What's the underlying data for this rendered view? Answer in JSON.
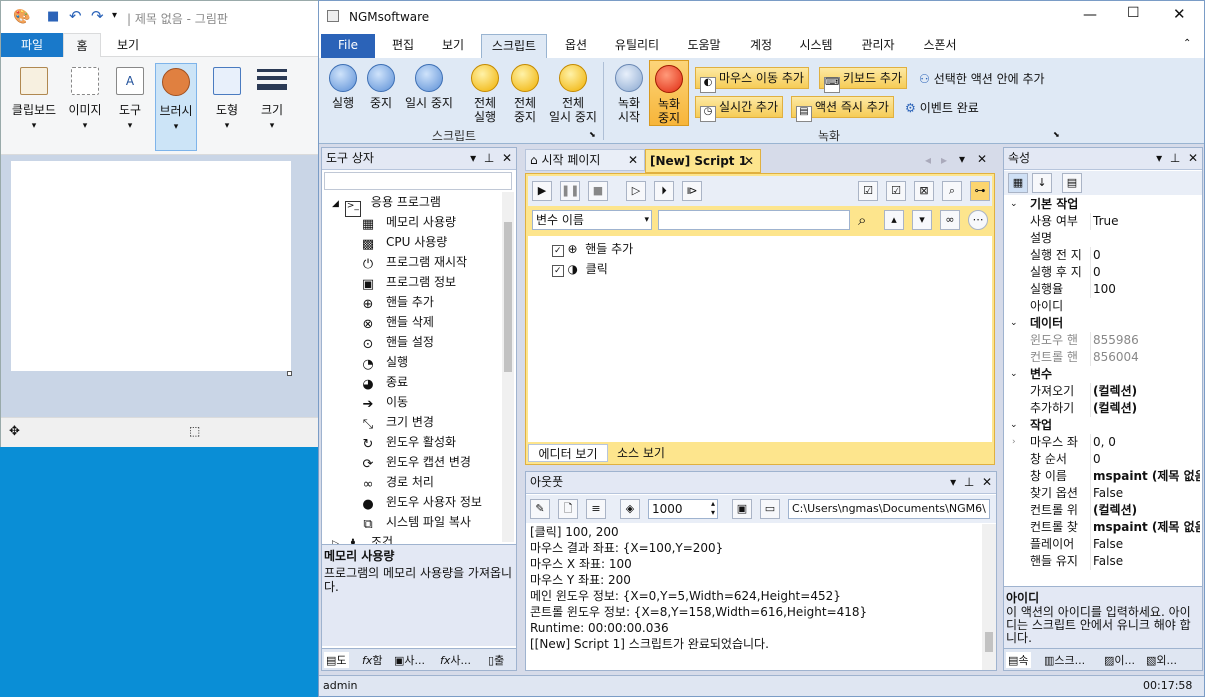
{
  "paint": {
    "title": "| 제목 없음 - 그림판",
    "tabs": [
      "파일",
      "홈",
      "보기"
    ],
    "groups": [
      "클립보드",
      "이미지",
      "도구",
      "브러시",
      "도형",
      "크기"
    ],
    "status_move_icon": "move-icon",
    "status_select_icon": "selection-icon"
  },
  "app": {
    "title": "NGMsoftware",
    "menu": [
      "File",
      "편집",
      "보기",
      "스크립트",
      "옵션",
      "유틸리티",
      "도움말",
      "계정",
      "시스템",
      "관리자",
      "스폰서"
    ],
    "active_menu": "스크립트",
    "accent": "#2b63b8"
  },
  "ribbon": {
    "script_buttons": [
      {
        "label1": "실행",
        "label2": ""
      },
      {
        "label1": "중지",
        "label2": ""
      },
      {
        "label1": "일시 중지",
        "label2": ""
      },
      {
        "label1": "전체",
        "label2": "실행"
      },
      {
        "label1": "전체",
        "label2": "중지"
      },
      {
        "label1": "전체",
        "label2": "일시 중지"
      }
    ],
    "script_group": "스크립트",
    "record_buttons": [
      {
        "label1": "녹화",
        "label2": "시작"
      },
      {
        "label1": "녹화",
        "label2": "중지"
      }
    ],
    "record_group": "녹화",
    "mouse_move_add": "마우스 이동 추가",
    "keyboard_add": "키보드 추가",
    "in_selected_action_add": "선택한 액션 안에 추가",
    "realtime_add": "실시간 추가",
    "action_instant_add": "액션 즉시 추가",
    "event_complete": "이벤트 완료"
  },
  "toolbox": {
    "title": "도구 상자",
    "root": "응용 프로그램",
    "items": [
      "메모리 사용량",
      "CPU 사용량",
      "프로그램 재시작",
      "프로그램 정보",
      "핸들 추가",
      "핸들 삭제",
      "핸들 설정",
      "실행",
      "종료",
      "이동",
      "크기 변경",
      "윈도우 활성화",
      "윈도우 캡션 변경",
      "경로 처리",
      "윈도우 사용자 정보",
      "시스템 파일 복사"
    ],
    "next_root": "조건",
    "desc_title": "메모리 사용량",
    "desc_text": "프로그램의 메모리 사용량을 가져옵니다.",
    "bottom_tabs": [
      "도",
      "함",
      "사...",
      "사...",
      "출"
    ]
  },
  "editor": {
    "tabs": [
      "시작 페이지",
      "[New] Script 1"
    ],
    "var_placeholder": "변수 이름",
    "nodes": [
      "핸들 추가",
      "클릭"
    ],
    "bottom_tabs": [
      "에디터 보기",
      "소스 보기"
    ]
  },
  "output": {
    "title": "아웃풋",
    "count": "1000",
    "path": "C:\\Users\\ngmas\\Documents\\NGM6\\",
    "lines": [
      "[클릭] 100, 200",
      "마우스 결과 좌표: {X=100,Y=200}",
      "마우스 X 좌표: 100",
      "마우스 Y 좌표: 200",
      "메인 윈도우 정보: {X=0,Y=5,Width=624,Height=452}",
      "콘트롤 윈도우 정보: {X=8,Y=158,Width=616,Height=418}",
      "Runtime: 00:00:00.036",
      "[[New] Script 1] 스크립트가 완료되었습니다."
    ]
  },
  "properties": {
    "title": "속성",
    "categories": [
      {
        "name": "기본 작업",
        "rows": [
          [
            "사용 여부",
            "True"
          ],
          [
            "설명",
            ""
          ],
          [
            "실행 전 지",
            "0"
          ],
          [
            "실행 후 지",
            "0"
          ],
          [
            "실행율",
            "100"
          ],
          [
            "아이디",
            ""
          ]
        ]
      },
      {
        "name": "데이터",
        "rows": [
          [
            "윈도우 핸",
            "855986"
          ],
          [
            "컨트롤 핸",
            "856004"
          ]
        ]
      },
      {
        "name": "변수",
        "rows": [
          [
            "가져오기",
            "(컬렉션)"
          ],
          [
            "추가하기",
            "(컬렉션)"
          ]
        ]
      },
      {
        "name": "작업",
        "rows": [
          [
            "마우스 좌",
            "0, 0"
          ],
          [
            "창 순서",
            "0"
          ],
          [
            "창 이름",
            "mspaint (제목 없음"
          ],
          [
            "찾기 옵션",
            "False"
          ],
          [
            "컨트롤 위",
            "(컬렉션)"
          ],
          [
            "컨트롤 찾",
            "mspaint (제목 없음"
          ],
          [
            "플레이어",
            "False"
          ],
          [
            "핸들 유지",
            "False"
          ]
        ]
      }
    ],
    "desc_title": "아이디",
    "desc_text": "이 액션의 아이디를 입력하세요. 아이디는 스크립트 안에서 유니크 해야 합니다.",
    "bottom_tabs": [
      "속",
      "스크...",
      "이...",
      "외..."
    ]
  },
  "status": {
    "user": "admin",
    "time": "00:17:58"
  }
}
